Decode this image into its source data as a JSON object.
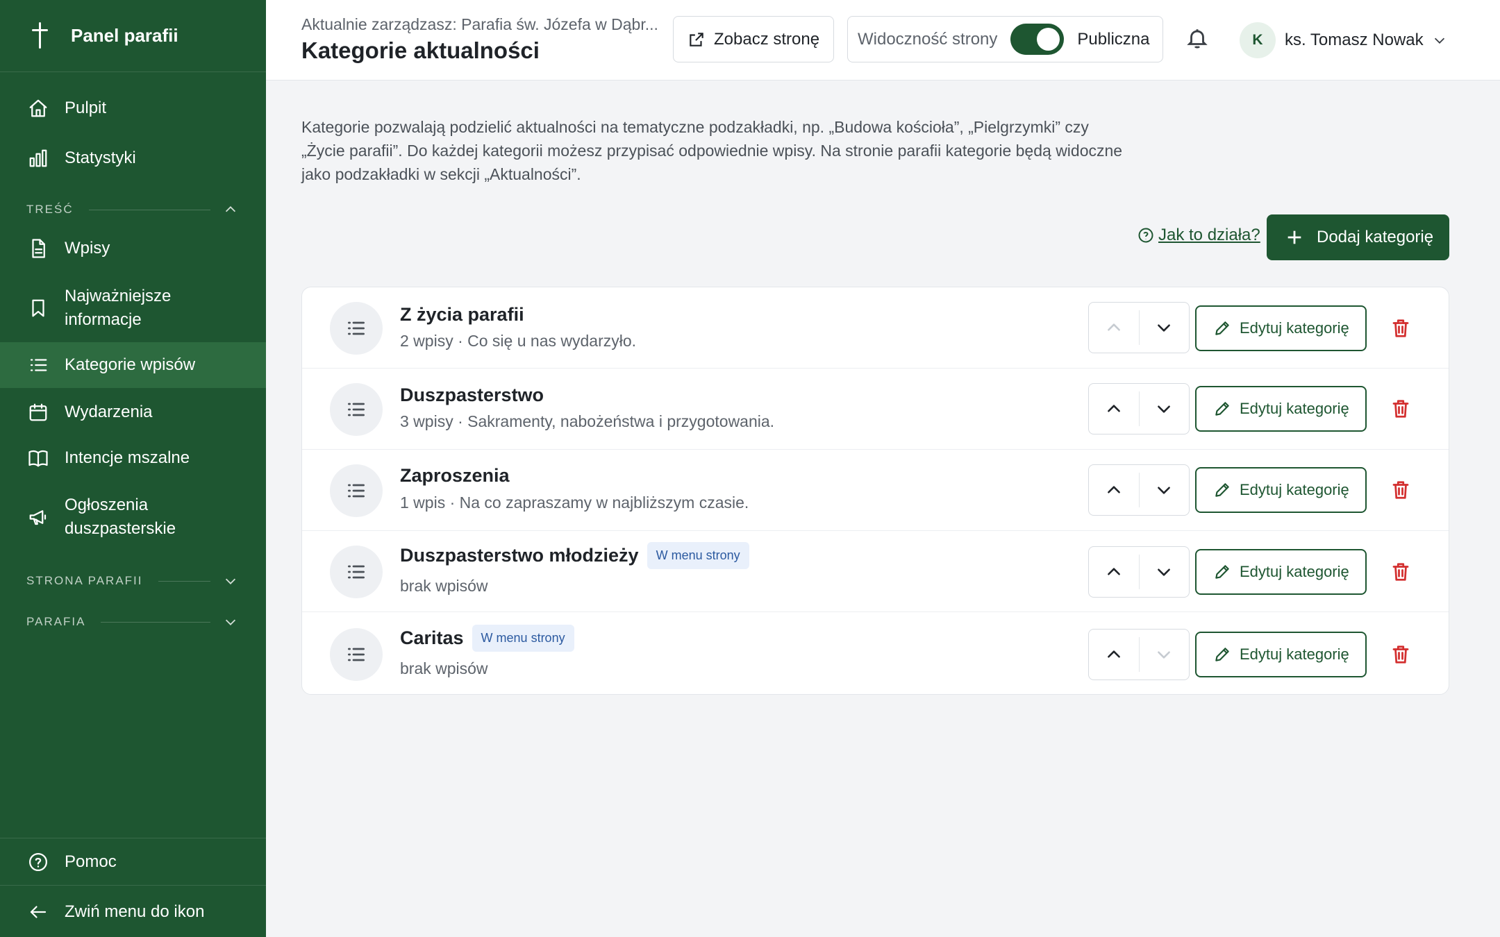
{
  "sidebar": {
    "brand": "Panel parafii",
    "items": {
      "pulpit": "Pulpit",
      "statystyki": "Statystyki",
      "wpisy": "Wpisy",
      "najwazniejsze_1": "Najważniejsze",
      "najwazniejsze_2": "informacje",
      "kategorie": "Kategorie wpisów",
      "wydarzenia": "Wydarzenia",
      "intencje": "Intencje mszalne",
      "ogloszenia_1": "Ogłoszenia",
      "ogloszenia_2": "duszpasterskie",
      "pomoc": "Pomoc",
      "zwin": "Zwiń menu do ikon"
    },
    "sections": {
      "tresc": "TREŚĆ",
      "strona": "STRONA PARAFII",
      "parafia": "PARAFIA"
    },
    "active": "Kategorie wpisów"
  },
  "header": {
    "crumb": "Aktualnie zarządzasz: Parafia św. Józefa w Dąbr...",
    "title": "Kategorie aktualności",
    "view_button": "Zobacz stronę",
    "visibility_label": "Widoczność strony",
    "visibility_on": true,
    "visibility_state": "Publiczna",
    "avatar_initial": "K",
    "user_name": "ks. Tomasz Nowak"
  },
  "main": {
    "intro_1": "Kategorie pozwalają podzielić aktualności na tematyczne podzakładki, np. „Budowa kościoła”, „Pielgrzymki” czy",
    "intro_2": "„Życie parafii”. Do każdej kategorii możesz przypisać odpowiednie wpisy. Na stronie parafii kategorie będą widoczne",
    "intro_3": "jako podzakładki w sekcji „Aktualności”.",
    "help_link": "Jak to działa?",
    "add_button": "Dodaj kategorię",
    "edit_label": "Edytuj kategorię",
    "categories": [
      {
        "title": "Z życia parafii",
        "badge": "",
        "meta": "2 wpisy · Co się u nas wydarzyło."
      },
      {
        "title": "Duszpasterstwo",
        "badge": "",
        "meta": "3 wpisy · Sakramenty, nabożeństwa i przygotowania."
      },
      {
        "title": "Zaproszenia",
        "badge": "",
        "meta": "1 wpis · Na co zapraszamy w najbliższym czasie."
      },
      {
        "title": "Duszpasterstwo młodzieży",
        "badge": "W menu strony",
        "meta": "brak wpisów"
      },
      {
        "title": "Caritas",
        "badge": "W menu strony",
        "meta": "brak wpisów"
      }
    ]
  },
  "colors": {
    "brand": "#1e5631",
    "active_nav": "#2d6b40",
    "danger": "#d32f2f",
    "badge_bg": "#e9f0fb",
    "badge_fg": "#2c5aa0"
  },
  "icons": [
    "cross-icon",
    "home-icon",
    "bar-chart-icon",
    "document-icon",
    "bookmark-icon",
    "list-icon",
    "calendar-icon",
    "book-icon",
    "megaphone-icon",
    "help-circle-icon",
    "arrow-left-icon",
    "external-link-icon",
    "bell-icon",
    "chevron-down-icon",
    "chevron-up-icon",
    "plus-icon",
    "pencil-icon",
    "trash-icon"
  ]
}
